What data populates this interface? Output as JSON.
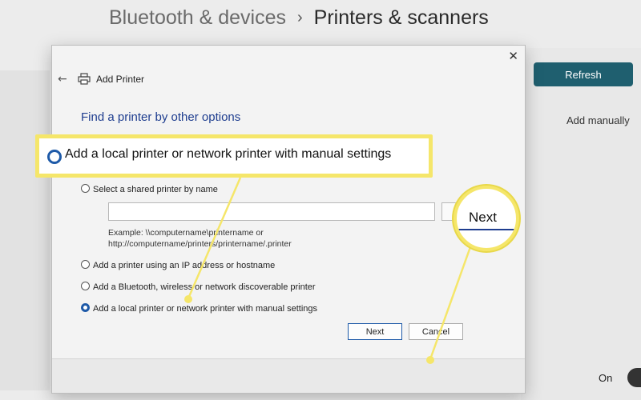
{
  "header": {
    "breadcrumb_parent": "Bluetooth & devices",
    "separator": "›",
    "breadcrumb_current": "Printers & scanners"
  },
  "background": {
    "refresh_label": "Refresh",
    "add_manually_label": "Add manually",
    "toggle_label": "On"
  },
  "dialog": {
    "title": "Add Printer",
    "close_glyph": "✕",
    "back_glyph": "←",
    "heading": "Find a printer by other options",
    "options": [
      {
        "label": "Select a shared printer by name",
        "selected": false
      },
      {
        "label": "Add a printer using an IP address or hostname",
        "selected": false
      },
      {
        "label": "Add a Bluetooth, wireless or network discoverable printer",
        "selected": false
      },
      {
        "label": "Add a local printer or network printer with manual settings",
        "selected": true
      }
    ],
    "shared_input_value": "",
    "example_line1": "Example: \\\\computername\\printername or",
    "example_line2": "http://computername/printers/printername/.printer",
    "next_label": "Next",
    "cancel_label": "Cancel"
  },
  "callouts": {
    "option_zoom_text": "Add a local printer or network printer with manual settings",
    "next_zoom_text": "Next",
    "highlight_color": "#f5e66a"
  }
}
